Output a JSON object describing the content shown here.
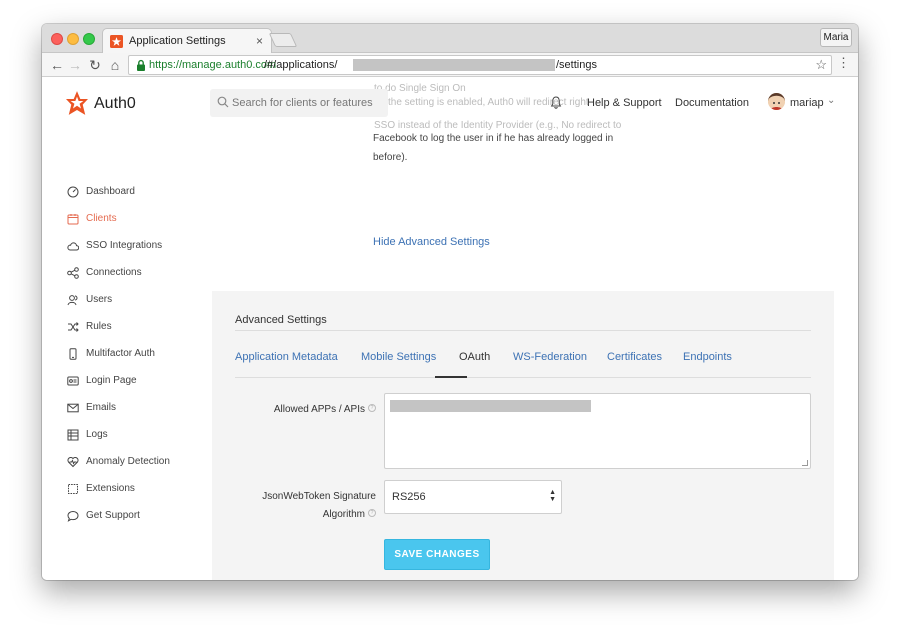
{
  "browser": {
    "tab_title": "Application Settings",
    "tab_close": "×",
    "profile_name": "Maria",
    "url_prefix": "https://manage.auth0.com",
    "url_path": "/#/applications/",
    "url_suffix": "/settings",
    "nav": {
      "back": "←",
      "forward": "→",
      "reload": "↻",
      "home": "⌂"
    },
    "star": "☆",
    "menu": "⋮"
  },
  "header": {
    "brand": "Auth0",
    "search_placeholder": "Search for clients or features",
    "help_support": "Help & Support",
    "documentation": "Documentation",
    "user": "mariap",
    "user_chevron": "⌄"
  },
  "background_text": {
    "line1": "to do Single Sign On",
    "line2": "the setting is enabled, Auth0 will redirect right",
    "line3": "SSO instead of the Identity Provider (e.g., No redirect to"
  },
  "content": {
    "text_line1": "Facebook to log the user in if he has already logged in",
    "text_line2": "before).",
    "hide_advanced": "Hide Advanced Settings"
  },
  "sidebar": {
    "items": [
      {
        "label": "Dashboard",
        "icon": "dashboard-icon"
      },
      {
        "label": "Clients",
        "icon": "clients-icon",
        "active": true
      },
      {
        "label": "SSO Integrations",
        "icon": "cloud-icon"
      },
      {
        "label": "Connections",
        "icon": "connections-icon"
      },
      {
        "label": "Users",
        "icon": "users-icon"
      },
      {
        "label": "Rules",
        "icon": "rules-icon"
      },
      {
        "label": "Multifactor Auth",
        "icon": "phone-icon"
      },
      {
        "label": "Login Page",
        "icon": "login-page-icon"
      },
      {
        "label": "Emails",
        "icon": "mail-icon"
      },
      {
        "label": "Logs",
        "icon": "logs-icon"
      },
      {
        "label": "Anomaly Detection",
        "icon": "heart-icon"
      },
      {
        "label": "Extensions",
        "icon": "extensions-icon"
      },
      {
        "label": "Get Support",
        "icon": "chat-icon"
      }
    ]
  },
  "advanced": {
    "title": "Advanced Settings",
    "tabs": [
      {
        "label": "Application Metadata"
      },
      {
        "label": "Mobile Settings"
      },
      {
        "label": "OAuth",
        "active": true
      },
      {
        "label": "WS-Federation"
      },
      {
        "label": "Certificates"
      },
      {
        "label": "Endpoints"
      }
    ],
    "allowed_apps_label": "Allowed APPs / APIs",
    "jwt_label_line1": "JsonWebToken Signature",
    "jwt_label_line2": "Algorithm",
    "jwt_value": "RS256",
    "help_mark": "?",
    "save_button": "SAVE CHANGES"
  },
  "colors": {
    "brand": "#eb5424",
    "link": "#3d72b4",
    "active_nav": "#e46a4f",
    "save_button": "#4ac6ee"
  }
}
